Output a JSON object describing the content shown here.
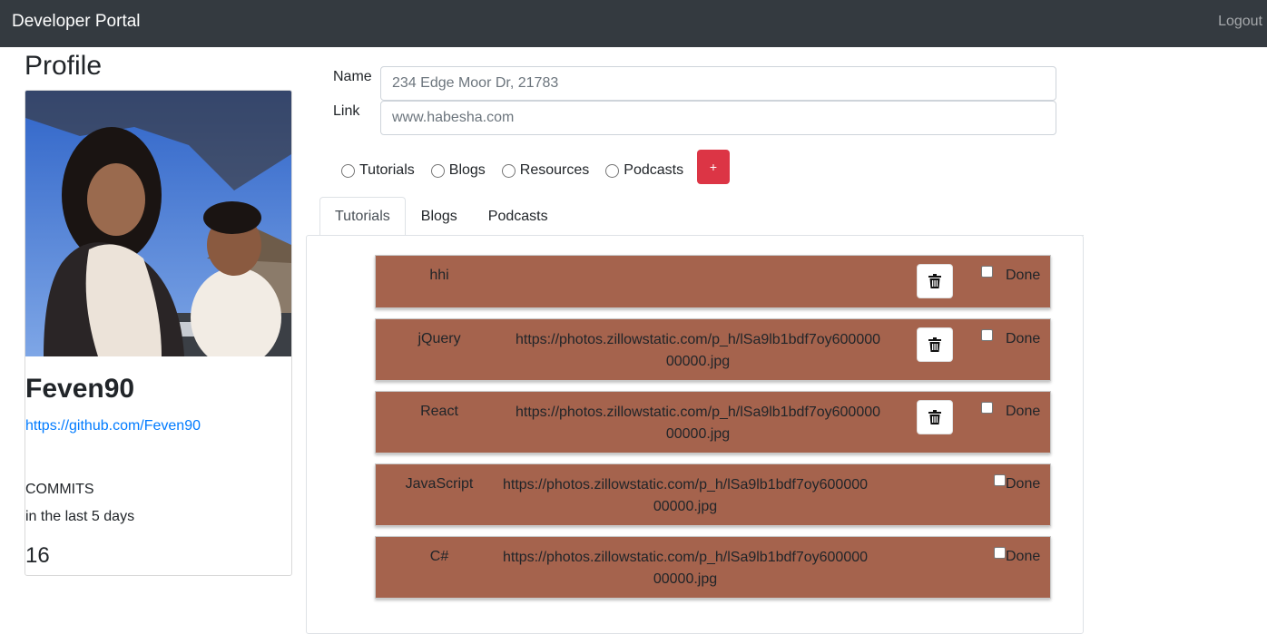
{
  "navbar": {
    "brand": "Developer Portal",
    "logout": "Logout"
  },
  "profile": {
    "title": "Profile",
    "photo_alt": "profile photo of a woman holding a toddler outdoors",
    "username": "Feven90",
    "github_url": "https://github.com/Feven90",
    "commits_label": "COMMITS",
    "commits_sub": "in the last 5 days",
    "commits_count": "16"
  },
  "form": {
    "name_label": "Name",
    "name_placeholder": "234 Edge Moor Dr, 21783",
    "link_label": "Link",
    "link_placeholder": "www.habesha.com",
    "radio_options": [
      "Tutorials",
      "Blogs",
      "Resources",
      "Podcasts"
    ],
    "add_button": "+"
  },
  "tabs": [
    {
      "label": "Tutorials",
      "active": true
    },
    {
      "label": "Blogs",
      "active": false
    },
    {
      "label": "Podcasts",
      "active": false
    }
  ],
  "resources": [
    {
      "name": "hhi",
      "url": "",
      "has_delete": true,
      "done_label": "Done",
      "done": false
    },
    {
      "name": "jQuery",
      "url": "https://photos.zillowstatic.com/p_h/lSa9lb1bdf7oy60000000000.jpg",
      "has_delete": true,
      "done_label": "Done",
      "done": false
    },
    {
      "name": "React",
      "url": "https://photos.zillowstatic.com/p_h/lSa9lb1bdf7oy60000000000.jpg",
      "has_delete": true,
      "done_label": "Done",
      "done": false
    },
    {
      "name": "JavaScript",
      "url": "https://photos.zillowstatic.com/p_h/lSa9lb1bdf7oy60000000000.jpg",
      "has_delete": false,
      "done_label": "Done",
      "done": false
    },
    {
      "name": "C#",
      "url": "https://photos.zillowstatic.com/p_h/lSa9lb1bdf7oy60000000000.jpg",
      "has_delete": false,
      "done_label": "Done",
      "done": false
    }
  ],
  "colors": {
    "navbar_bg": "#343a40",
    "card_bg": "#a5634d",
    "add_button_bg": "#dc3545",
    "link": "#007bff"
  },
  "icons": {
    "delete": "trash-icon"
  }
}
